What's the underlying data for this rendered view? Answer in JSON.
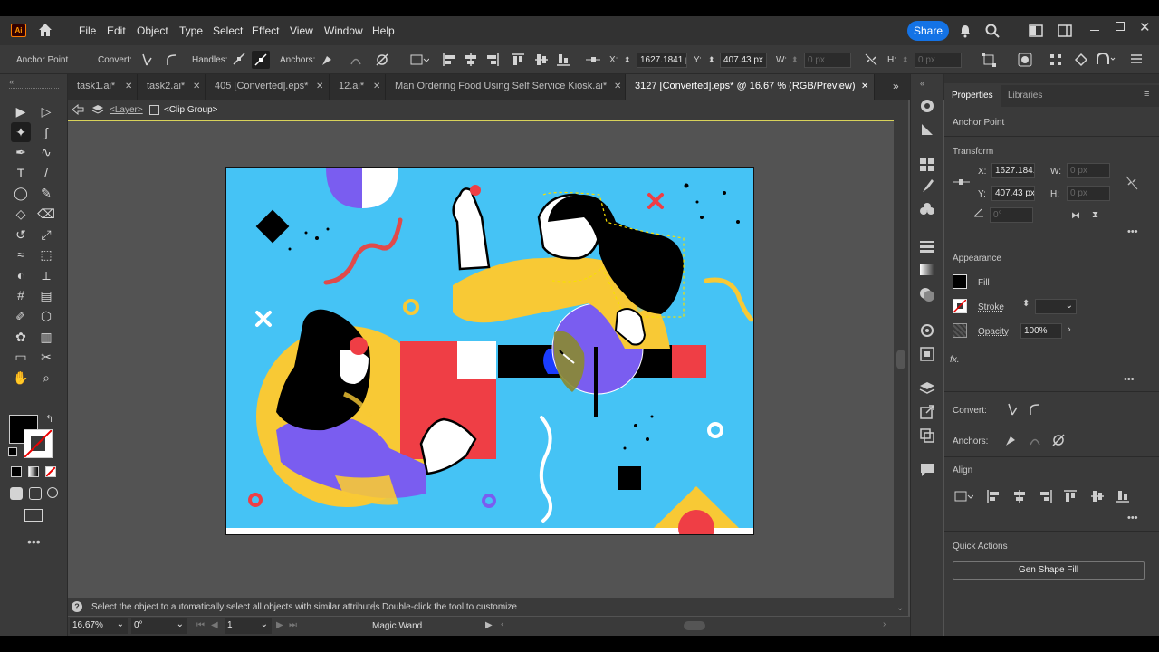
{
  "app": {
    "logo": "Ai"
  },
  "menu": [
    "File",
    "Edit",
    "Object",
    "Type",
    "Select",
    "Effect",
    "View",
    "Window",
    "Help"
  ],
  "share_label": "Share",
  "control_bar": {
    "selection_label": "Anchor Point",
    "convert_label": "Convert:",
    "handles_label": "Handles:",
    "anchors_label": "Anchors:",
    "x_label": "X:",
    "x_value": "1627.1841 p",
    "y_label": "Y:",
    "y_value": "407.43 px",
    "w_label": "W:",
    "w_value": "0 px",
    "h_label": "H:",
    "h_value": "0 px"
  },
  "tabs": [
    {
      "label": "task1.ai*"
    },
    {
      "label": "task2.ai*"
    },
    {
      "label": "405 [Converted].eps*"
    },
    {
      "label": "12.ai*"
    },
    {
      "label": "Man Ordering Food Using Self Service Kiosk.ai*"
    },
    {
      "label": "3127 [Converted].eps* @ 16.67 % (RGB/Preview)"
    }
  ],
  "breadcrumb": {
    "layer": "<Layer>",
    "group": "<Clip Group>"
  },
  "status": {
    "hint": "Select the object to automatically select all objects with similar attributes",
    "hint2": "Double-click the tool to customize",
    "zoom": "16.67%",
    "rotation": "0°",
    "artboard": "1",
    "tool": "Magic Wand"
  },
  "properties": {
    "tab_properties": "Properties",
    "tab_libraries": "Libraries",
    "selection": "Anchor Point",
    "transform_title": "Transform",
    "x_label": "X:",
    "x_value": "1627.1841",
    "y_label": "Y:",
    "y_value": "407.43 px",
    "w_label": "W:",
    "w_value": "0 px",
    "h_label": "H:",
    "h_value": "0 px",
    "angle_value": "0°",
    "appearance_title": "Appearance",
    "fill_label": "Fill",
    "stroke_label": "Stroke",
    "opacity_label": "Opacity",
    "opacity_value": "100%",
    "fx_label": "fx.",
    "convert_label": "Convert:",
    "anchors_label": "Anchors:",
    "align_title": "Align",
    "quick_actions_title": "Quick Actions",
    "gen_shape_fill": "Gen Shape Fill"
  },
  "colors": {
    "artboard_bg": "#45c3f5",
    "yellow": "#f8c935",
    "red": "#ef3e45",
    "purple": "#7a5df0",
    "share_blue": "#1473e6"
  }
}
